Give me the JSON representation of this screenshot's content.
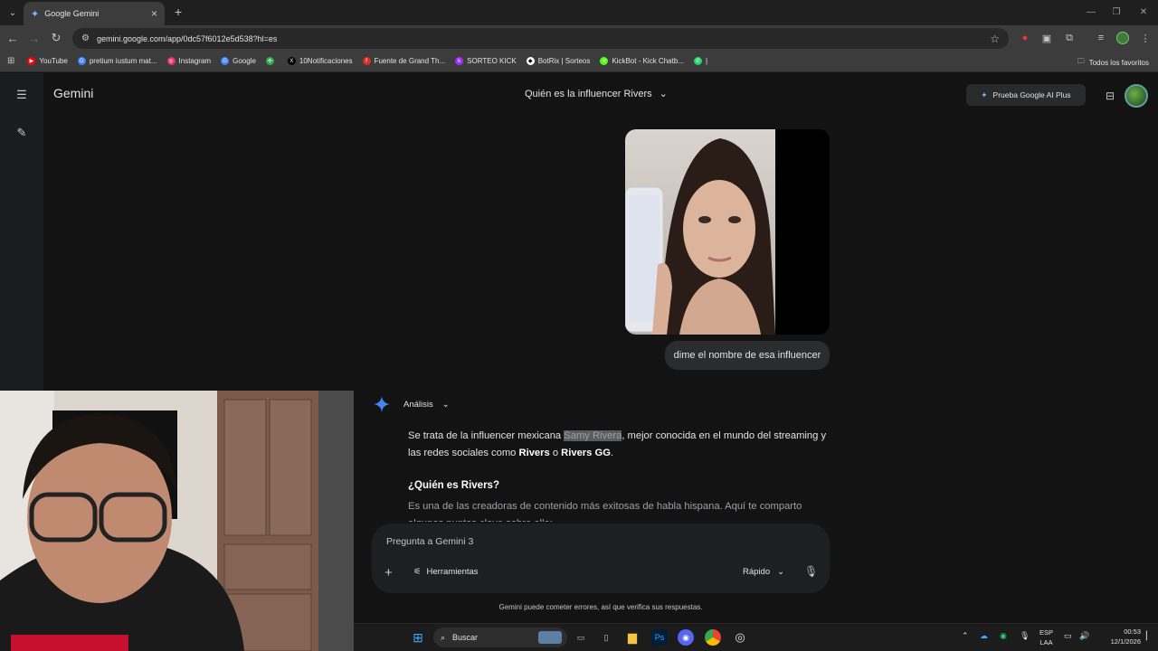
{
  "browser": {
    "tab_title": "Google Gemini",
    "url": "gemini.google.com/app/0dc57f6012e5d538?hl=es",
    "bookmarks": [
      {
        "label": "YouTube",
        "icon": "youtube-icon",
        "color": "#ff0000"
      },
      {
        "label": "pretium iustum mat...",
        "icon": "google-icon",
        "color": "#4285f4"
      },
      {
        "label": "Instagram",
        "icon": "instagram-icon",
        "color": "#e1306c"
      },
      {
        "label": "Google",
        "icon": "google-icon",
        "color": "#4285f4"
      },
      {
        "label": "",
        "icon": "pinwheel-icon",
        "color": "#34a853"
      },
      {
        "label": "10Notificaciones",
        "icon": "x-icon",
        "color": "#000000"
      },
      {
        "label": "Fuente de Grand Th...",
        "icon": "font-icon",
        "color": "#d93025"
      },
      {
        "label": "SORTEO KICK",
        "icon": "kick-icon",
        "color": "#9b30ff"
      },
      {
        "label": "BotRix | Sorteos",
        "icon": "botrix-icon",
        "color": "#ffffff"
      },
      {
        "label": "KickBot - Kick Chatb...",
        "icon": "kickbot-icon",
        "color": "#53fc18"
      },
      {
        "label": "|",
        "icon": "whatsapp-icon",
        "color": "#25d366"
      }
    ],
    "all_bookmarks": "Todos los favoritos"
  },
  "gemini": {
    "brand": "Gemini",
    "conversation_title": "Quién es la influencer Rivers",
    "upgrade_label": "Prueba Google AI Plus",
    "user_message": "dime el nombre de esa influencer",
    "analysis_label": "Análisis",
    "response": {
      "p1_before": "Se trata de la influencer mexicana ",
      "p1_highlight": "Samy Rivera",
      "p1_after": ", mejor conocida en el mundo del streaming y las redes sociales como ",
      "p1_b1": "Rivers",
      "p1_mid": " o ",
      "p1_b2": "Rivers GG",
      "p1_end": ".",
      "heading": "¿Quién es Rivers?",
      "p2": "Es una de las creadoras de contenido más exitosas de habla hispana. Aquí te comparto algunos puntos clave sobre ella:"
    },
    "composer_placeholder": "Pregunta a Gemini 3",
    "tools_label": "Herramientas",
    "mode_label": "Rápido",
    "disclaimer": "Gemini puede cometer errores, así que verifica sus respuestas."
  },
  "taskbar": {
    "search_placeholder": "Buscar",
    "lang_line1": "ESP",
    "lang_line2": "LAA",
    "time": "00:53",
    "date": "12/1/2026"
  },
  "colors": {
    "accent_blue": "#4285f4",
    "background": "#131314"
  }
}
